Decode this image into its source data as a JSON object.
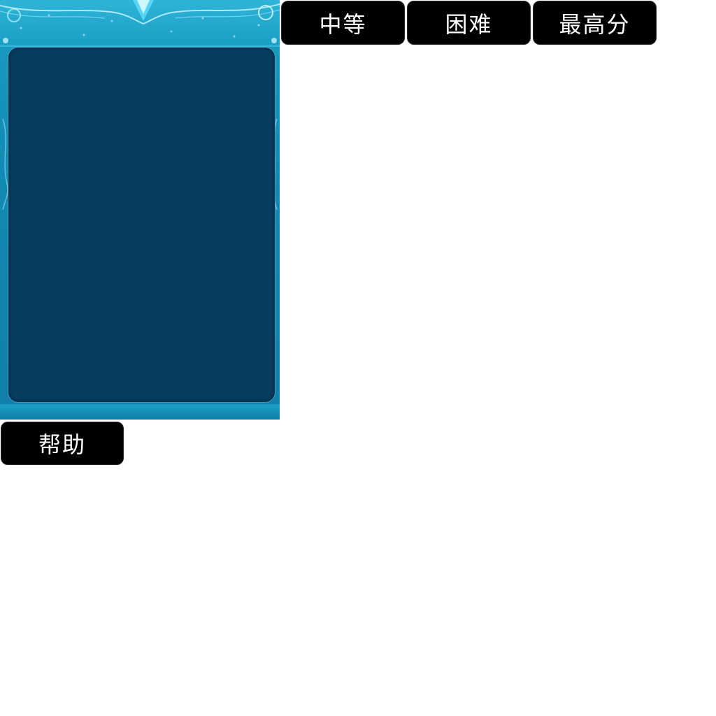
{
  "board": {
    "frame_color": "#1a9ec4",
    "inner_color": "#073c5e",
    "accent_color": "#2fb4d8"
  },
  "buttons": {
    "medium_label": "中等",
    "hard_label": "困难",
    "high_score_label": "最高分",
    "help_label": "帮助",
    "background_color": "#000000",
    "text_color": "#ffffff"
  }
}
